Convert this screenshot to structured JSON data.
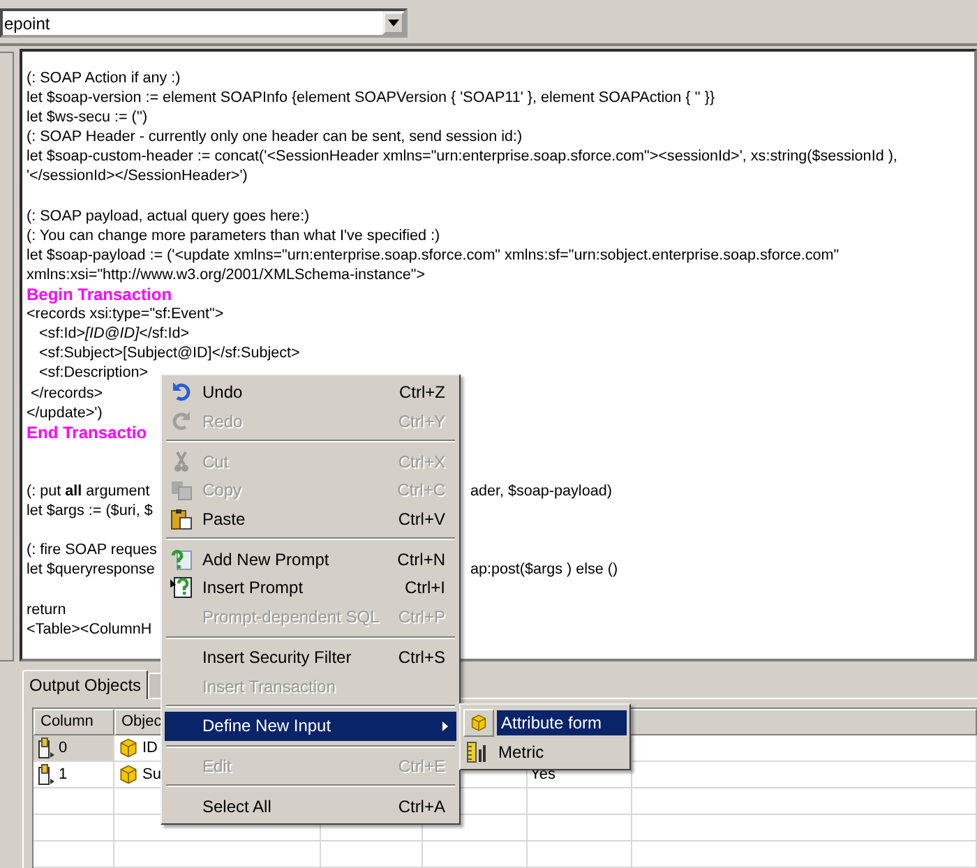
{
  "dropdown": {
    "value": "epoint"
  },
  "editor": {
    "lines": [
      {
        "kind": "code",
        "text": "(: SOAP Action if any :)"
      },
      {
        "kind": "code",
        "text": "let $soap-version := element SOAPInfo {element SOAPVersion { 'SOAP11' }, element SOAPAction { '' }}"
      },
      {
        "kind": "code",
        "text": "let $ws-secu := ('')"
      },
      {
        "kind": "code",
        "text": "(: SOAP Header - currently only one header can be sent, send session id:)"
      },
      {
        "kind": "code",
        "text": "let $soap-custom-header := concat('<SessionHeader xmlns=\"urn:enterprise.soap.sforce.com\"><sessionId>', xs:string($sessionId ),"
      },
      {
        "kind": "code",
        "text": "'</sessionId></SessionHeader>')"
      },
      {
        "kind": "blank"
      },
      {
        "kind": "code",
        "text": "(: SOAP payload, actual query goes here:)"
      },
      {
        "kind": "code",
        "text": "(: You can change more parameters than what I've specified :)"
      },
      {
        "kind": "code",
        "text": "let $soap-payload := ('<update xmlns=\"urn:enterprise.soap.sforce.com\" xmlns:sf=\"urn:sobject.enterprise.soap.sforce.com\""
      },
      {
        "kind": "code",
        "text": "xmlns:xsi=\"http://www.w3.org/2001/XMLSchema-instance\">"
      },
      {
        "kind": "marker",
        "text": "Begin Transaction"
      },
      {
        "kind": "code",
        "text": "<records xsi:type=\"sf:Event\">"
      },
      {
        "kind": "code",
        "text": "   <sf:Id>*[ID@ID]*</sf:Id>"
      },
      {
        "kind": "code",
        "text": "   <sf:Subject>[Subject@ID]</sf:Subject>"
      },
      {
        "kind": "code",
        "text": "   <sf:Description>"
      },
      {
        "kind": "code",
        "text": " </records>"
      },
      {
        "kind": "code",
        "text": "</update>')"
      },
      {
        "kind": "marker",
        "text": "End Transactio"
      },
      {
        "kind": "blank"
      },
      {
        "kind": "blank"
      },
      {
        "kind": "code",
        "text": "(: put **all** argument",
        "after": "ader, $soap-payload)"
      },
      {
        "kind": "code",
        "text": "let $args := ($uri, $"
      },
      {
        "kind": "blank"
      },
      {
        "kind": "code",
        "text": "(: fire SOAP reques"
      },
      {
        "kind": "code",
        "text": "let $queryresponse",
        "after": "ap:post($args ) else ()"
      },
      {
        "kind": "blank"
      },
      {
        "kind": "code",
        "text": "return"
      },
      {
        "kind": "code",
        "text": "<Table><ColumnH"
      }
    ]
  },
  "tabs": [
    {
      "label": "Output Objects",
      "selected": true
    }
  ],
  "table": {
    "columns": [
      "Column",
      "Objec"
    ],
    "rows": [
      {
        "selected": true,
        "cells": [
          "0",
          "ID"
        ]
      },
      {
        "selected": false,
        "cells": [
          "1",
          "Su"
        ],
        "column_5": "Yes"
      }
    ]
  },
  "context_menu": {
    "items": [
      {
        "kind": "item",
        "label": "Undo",
        "shortcut": "Ctrl+Z",
        "disabled": false
      },
      {
        "kind": "item",
        "label": "Redo",
        "shortcut": "Ctrl+Y",
        "disabled": true
      },
      {
        "kind": "separator"
      },
      {
        "kind": "item",
        "label": "Cut",
        "shortcut": "Ctrl+X",
        "disabled": true
      },
      {
        "kind": "item",
        "label": "Copy",
        "shortcut": "Ctrl+C",
        "disabled": true
      },
      {
        "kind": "item",
        "label": "Paste",
        "shortcut": "Ctrl+V",
        "disabled": false
      },
      {
        "kind": "separator"
      },
      {
        "kind": "item",
        "label": "Add New Prompt",
        "shortcut": "Ctrl+N",
        "disabled": false
      },
      {
        "kind": "item",
        "label": "Insert Prompt",
        "shortcut": "Ctrl+I",
        "disabled": false
      },
      {
        "kind": "item",
        "label": "Prompt-dependent SQL",
        "shortcut": "Ctrl+P",
        "disabled": true
      },
      {
        "kind": "separator"
      },
      {
        "kind": "item",
        "label": "Insert Security Filter",
        "shortcut": "Ctrl+S",
        "disabled": false
      },
      {
        "kind": "item",
        "label": "Insert Transaction",
        "disabled": true
      },
      {
        "kind": "separator"
      },
      {
        "kind": "submenu",
        "label": "Define New Input",
        "disabled": false,
        "selected": true
      },
      {
        "kind": "separator"
      },
      {
        "kind": "item",
        "label": "Edit",
        "shortcut": "Ctrl+E",
        "disabled": true
      },
      {
        "kind": "separator"
      },
      {
        "kind": "item",
        "label": "Select All",
        "shortcut": "Ctrl+A",
        "disabled": false
      }
    ]
  },
  "submenu": {
    "items": [
      {
        "label": "Attribute form",
        "selected": true
      },
      {
        "label": "Metric",
        "selected": false
      }
    ]
  }
}
